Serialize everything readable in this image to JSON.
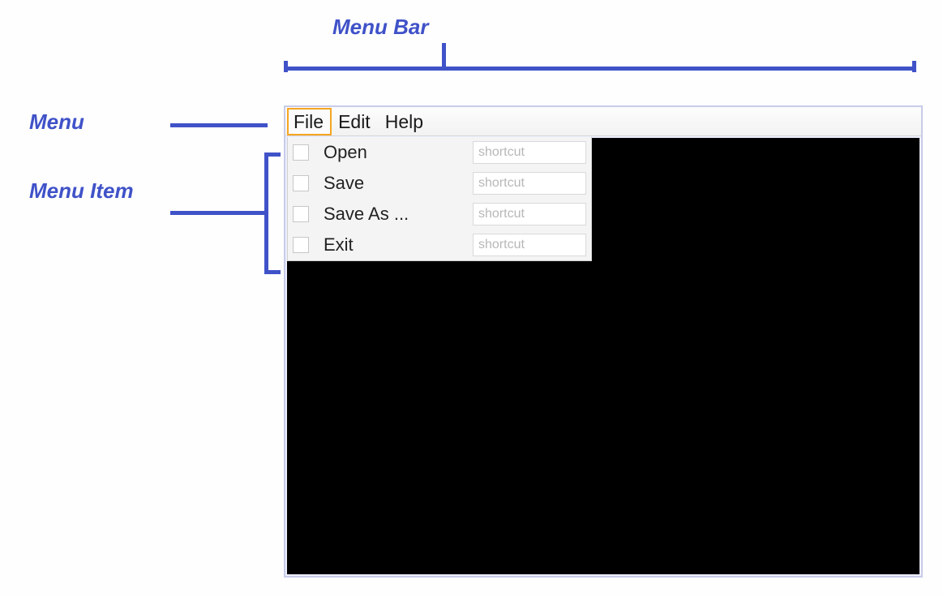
{
  "annotations": {
    "menubar": "Menu Bar",
    "menu": "Menu",
    "menuitem": "Menu Item"
  },
  "menubar": {
    "menus": [
      {
        "label": "File",
        "active": true
      },
      {
        "label": "Edit",
        "active": false
      },
      {
        "label": "Help",
        "active": false
      }
    ]
  },
  "dropdown": {
    "items": [
      {
        "label": "Open",
        "shortcut": "shortcut"
      },
      {
        "label": "Save",
        "shortcut": "shortcut"
      },
      {
        "label": "Save As ...",
        "shortcut": "shortcut"
      },
      {
        "label": "Exit",
        "shortcut": "shortcut"
      }
    ]
  },
  "colors": {
    "annotation": "#4052c8",
    "highlight": "#f5a623",
    "content_bg": "#000000"
  }
}
